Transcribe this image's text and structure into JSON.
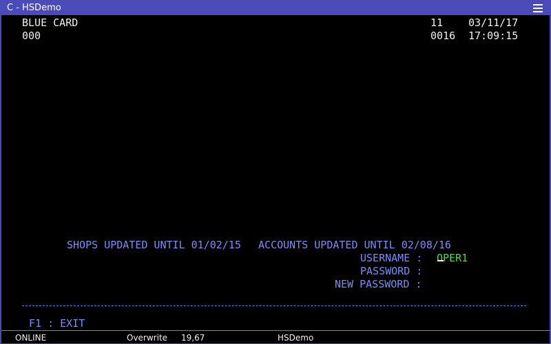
{
  "window": {
    "title": "C - HSDemo",
    "menu_icon": "hamburger-menu-icon"
  },
  "screen": {
    "app_name": "BLUE CARD",
    "app_code": "000",
    "terminal_id": "11",
    "date": "03/11/17",
    "session": "0016",
    "time": "17:09:15",
    "shops_updated": "SHOPS UPDATED UNTIL 01/02/15",
    "accounts_updated": "ACCOUNTS UPDATED UNTIL 02/08/16",
    "username_label": "USERNAME :",
    "username_value": "OPER1",
    "password_label": "PASSWORD :",
    "new_password_label": "NEW PASSWORD :",
    "separator": "--------------------------------------------------------------------------------",
    "f1_exit": "F1 : EXIT"
  },
  "statusbar": {
    "state": "ONLINE",
    "mode": "Overwrite",
    "cursor_pos": "19,67",
    "host": "HSDemo"
  },
  "colors": {
    "titlebar": "#4a4ab8",
    "screen_bg": "#000000",
    "text_white": "#f0f0f0",
    "text_blue": "#7c8cf8",
    "text_green": "#40e040"
  }
}
